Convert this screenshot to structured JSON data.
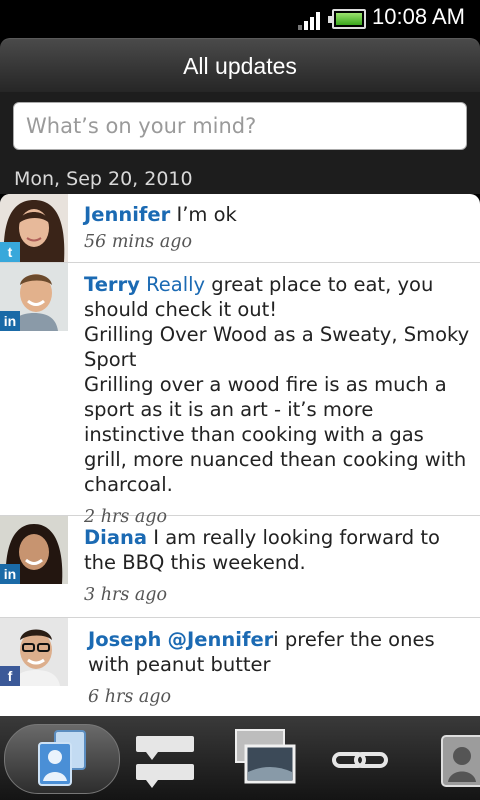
{
  "status_bar": {
    "time": "10:08 AM"
  },
  "header": {
    "title": "All updates"
  },
  "composer": {
    "placeholder": "What’s on your mind?"
  },
  "feed": {
    "date_header": "Mon, Sep 20, 2010",
    "posts": [
      {
        "author": "Jennifer",
        "network": "twitter",
        "text": " I’m ok",
        "time": "56 mins ago"
      },
      {
        "author": "Terry",
        "mention": "Really",
        "network": "linkedin",
        "text": " great place to eat, you should check it out!",
        "line2": "Grilling Over Wood as a Sweaty, Smoky Sport",
        "line3": "Grilling over a wood fire is as much a sport as it is an art - it’s more instinctive than cooking with a gas grill, more nuanced thean cooking with charcoal.",
        "time": "2 hrs ago"
      },
      {
        "author": "Diana",
        "network": "linkedin",
        "text": " I am really looking forward to the BBQ this weekend.",
        "time": "3 hrs ago"
      },
      {
        "author": "Joseph",
        "mention": "@Jennifer",
        "network": "facebook",
        "text": "i prefer the ones with peanut butter",
        "time": "6 hrs ago"
      }
    ]
  },
  "bottom_nav": {
    "items": [
      {
        "icon": "people-icon",
        "active": true
      },
      {
        "icon": "updates-list-icon",
        "active": false
      },
      {
        "icon": "photos-icon",
        "active": false
      },
      {
        "icon": "link-icon",
        "active": false
      },
      {
        "icon": "contact-card-icon",
        "active": false
      }
    ]
  },
  "colors": {
    "accent_blue": "#1b6ab3",
    "twitter": "#38a8db",
    "linkedin": "#1a6aa7",
    "facebook": "#3b5998"
  }
}
